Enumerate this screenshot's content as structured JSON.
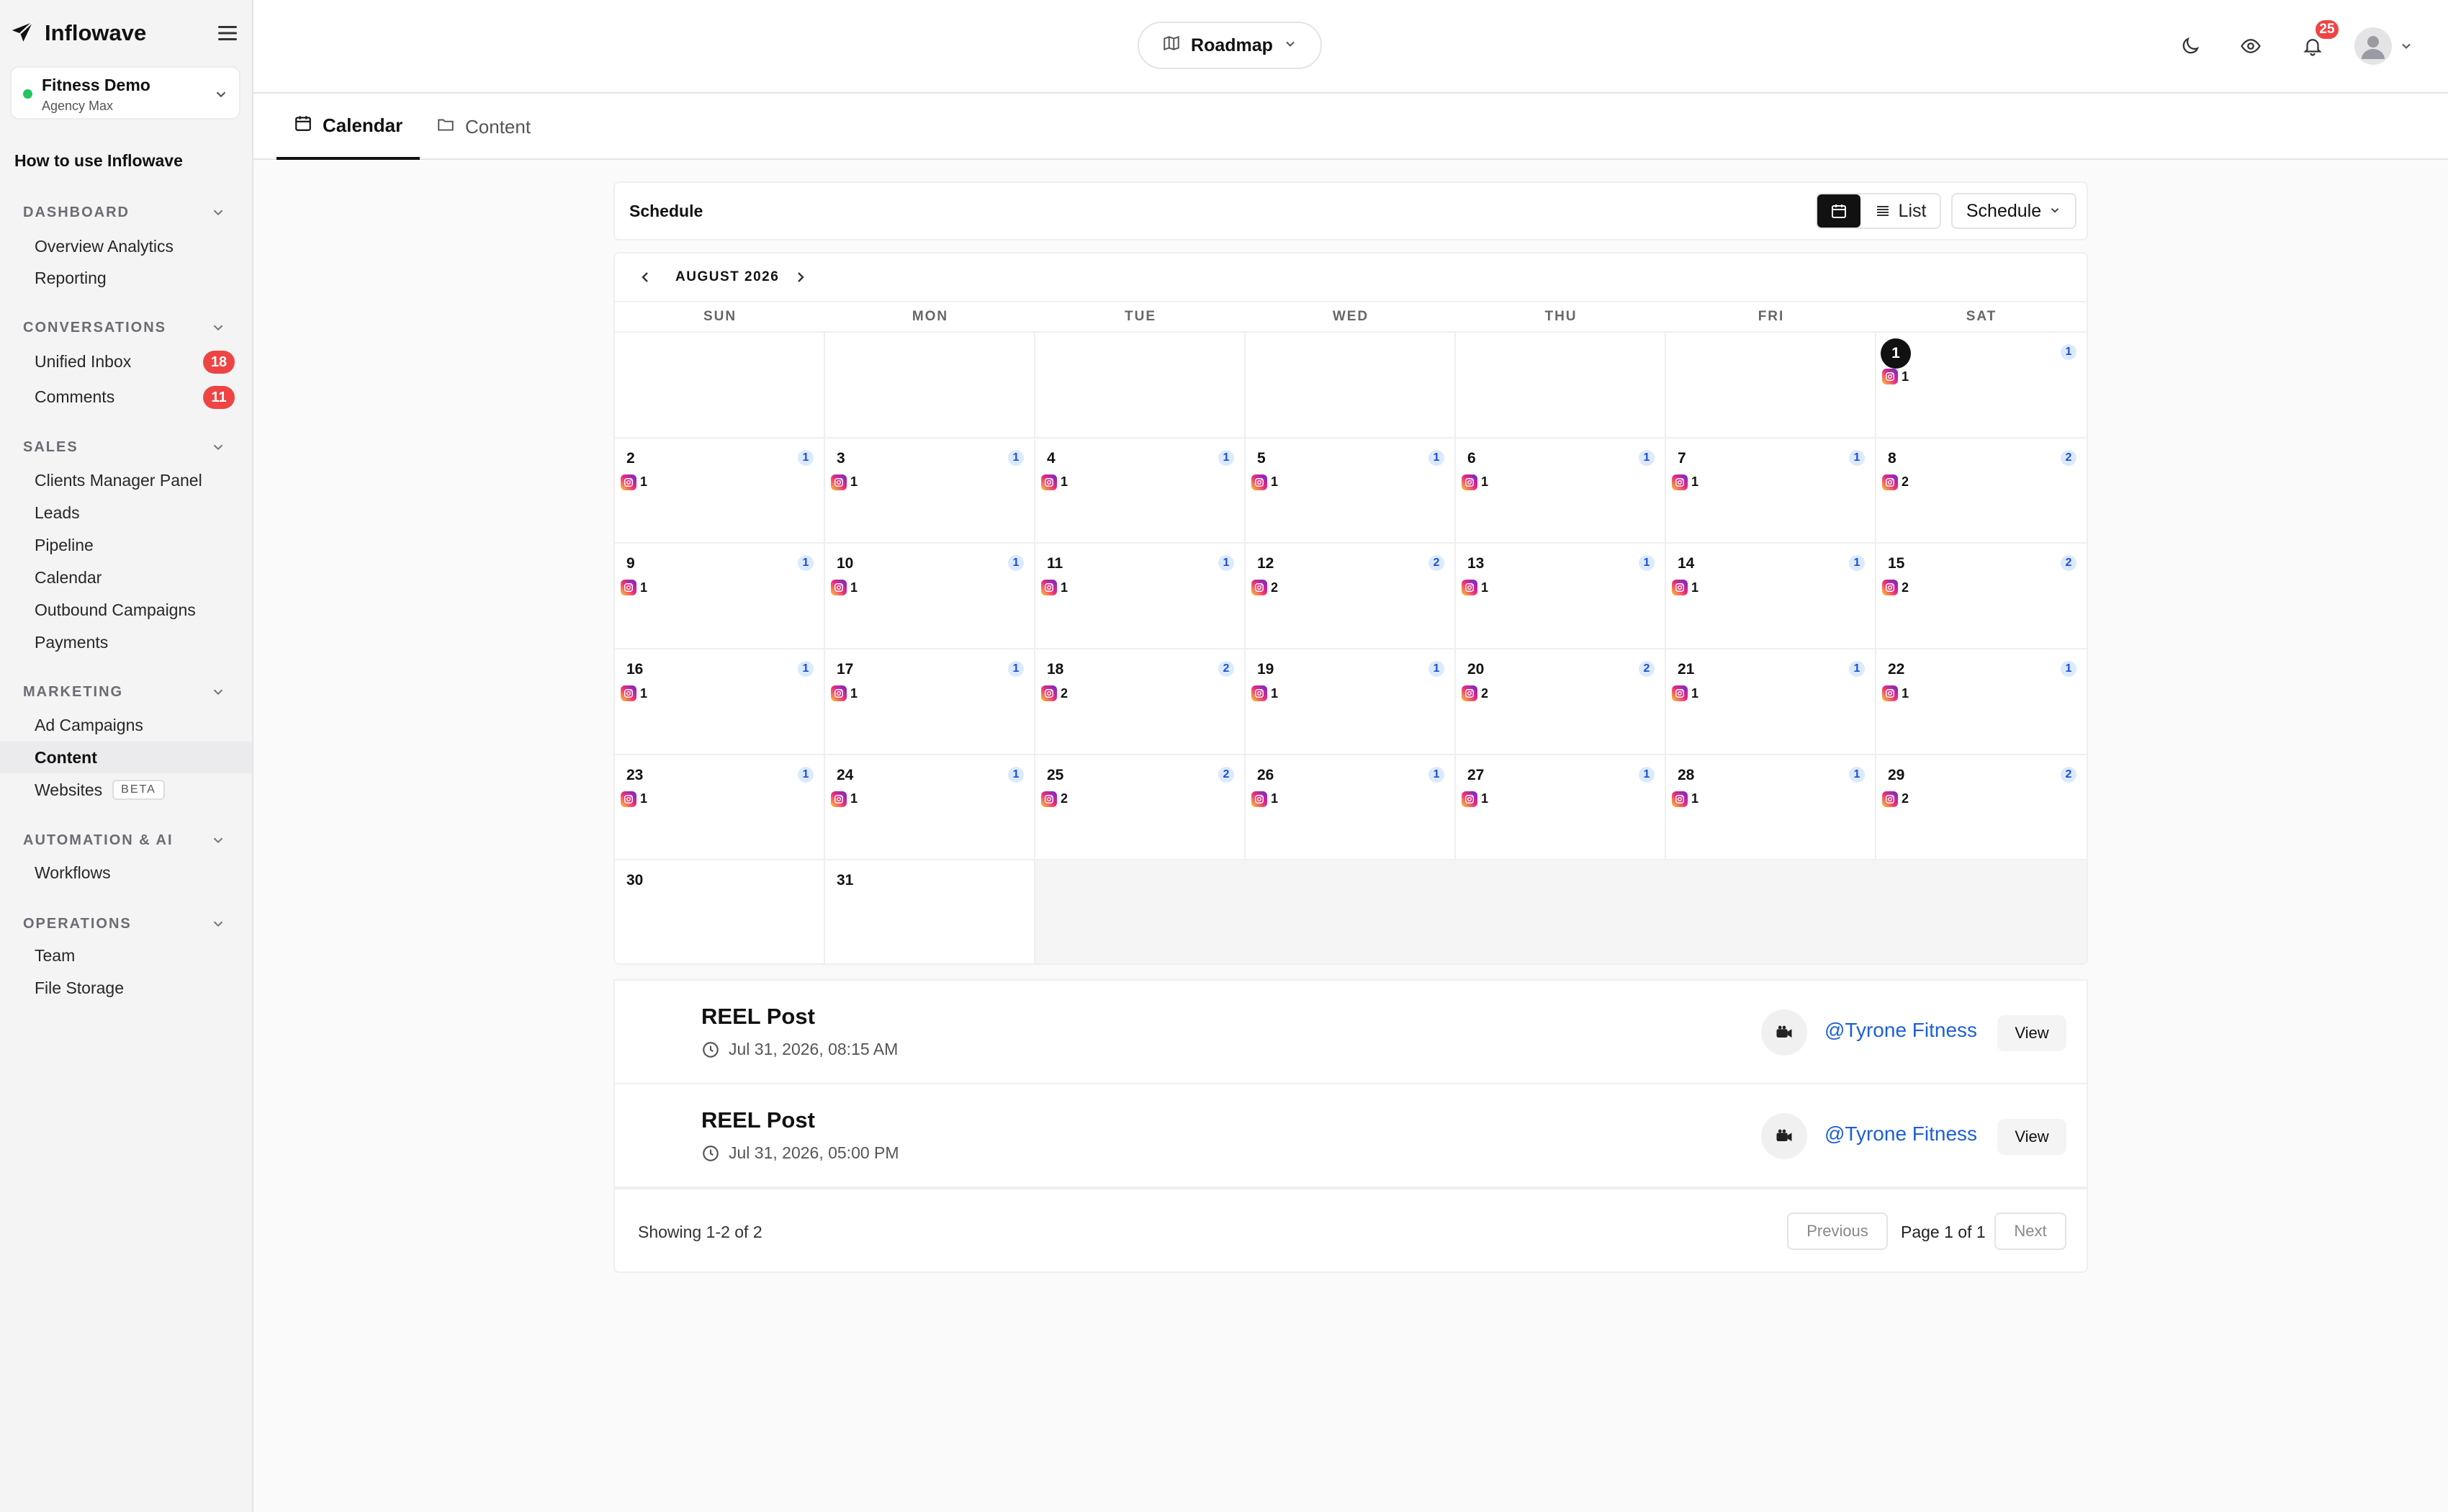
{
  "app": {
    "name": "Inflowave"
  },
  "workspace": {
    "name": "Fitness Demo",
    "subtitle": "Agency Max"
  },
  "help_link": "How to use Inflowave",
  "sidebar": {
    "sections": [
      {
        "title": "DASHBOARD",
        "items": [
          {
            "label": "Overview Analytics"
          },
          {
            "label": "Reporting"
          }
        ]
      },
      {
        "title": "CONVERSATIONS",
        "items": [
          {
            "label": "Unified Inbox",
            "badge": "18"
          },
          {
            "label": "Comments",
            "badge": "11"
          }
        ]
      },
      {
        "title": "SALES",
        "items": [
          {
            "label": "Clients Manager Panel"
          },
          {
            "label": "Leads"
          },
          {
            "label": "Pipeline"
          },
          {
            "label": "Calendar"
          },
          {
            "label": "Outbound Campaigns"
          },
          {
            "label": "Payments"
          }
        ]
      },
      {
        "title": "MARKETING",
        "items": [
          {
            "label": "Ad Campaigns"
          },
          {
            "label": "Content",
            "active": true
          },
          {
            "label": "Websites",
            "tag": "BETA"
          }
        ]
      },
      {
        "title": "AUTOMATION & AI",
        "items": [
          {
            "label": "Workflows"
          }
        ]
      },
      {
        "title": "OPERATIONS",
        "items": [
          {
            "label": "Team"
          },
          {
            "label": "File Storage"
          }
        ]
      }
    ]
  },
  "topbar": {
    "project_selector": "Roadmap",
    "notification_count": "25",
    "icons": [
      "moon-icon",
      "eye-icon",
      "bell-icon",
      "user-avatar-icon"
    ]
  },
  "tabs": [
    {
      "label": "Calendar",
      "active": true
    },
    {
      "label": "Content"
    }
  ],
  "schedule": {
    "title": "Schedule",
    "list_label": "List",
    "dropdown_label": "Schedule"
  },
  "calendar": {
    "month_label": "AUGUST 2026",
    "weekdays": [
      "SUN",
      "MON",
      "TUE",
      "WED",
      "THU",
      "FRI",
      "SAT"
    ],
    "today": 1,
    "days": [
      {
        "day": "",
        "empty": false
      },
      {
        "day": "",
        "empty": false
      },
      {
        "day": "",
        "empty": false
      },
      {
        "day": "",
        "empty": false
      },
      {
        "day": "",
        "empty": false
      },
      {
        "day": "",
        "empty": false
      },
      {
        "day": "1",
        "count": "1",
        "ig": "1",
        "today": true
      },
      {
        "day": "2",
        "count": "1",
        "ig": "1"
      },
      {
        "day": "3",
        "count": "1",
        "ig": "1"
      },
      {
        "day": "4",
        "count": "1",
        "ig": "1"
      },
      {
        "day": "5",
        "count": "1",
        "ig": "1"
      },
      {
        "day": "6",
        "count": "1",
        "ig": "1"
      },
      {
        "day": "7",
        "count": "1",
        "ig": "1"
      },
      {
        "day": "8",
        "count": "2",
        "ig": "2"
      },
      {
        "day": "9",
        "count": "1",
        "ig": "1"
      },
      {
        "day": "10",
        "count": "1",
        "ig": "1"
      },
      {
        "day": "11",
        "count": "1",
        "ig": "1"
      },
      {
        "day": "12",
        "count": "2",
        "ig": "2"
      },
      {
        "day": "13",
        "count": "1",
        "ig": "1"
      },
      {
        "day": "14",
        "count": "1",
        "ig": "1"
      },
      {
        "day": "15",
        "count": "2",
        "ig": "2"
      },
      {
        "day": "16",
        "count": "1",
        "ig": "1"
      },
      {
        "day": "17",
        "count": "1",
        "ig": "1"
      },
      {
        "day": "18",
        "count": "2",
        "ig": "2"
      },
      {
        "day": "19",
        "count": "1",
        "ig": "1"
      },
      {
        "day": "20",
        "count": "2",
        "ig": "2"
      },
      {
        "day": "21",
        "count": "1",
        "ig": "1"
      },
      {
        "day": "22",
        "count": "1",
        "ig": "1"
      },
      {
        "day": "23",
        "count": "1",
        "ig": "1"
      },
      {
        "day": "24",
        "count": "1",
        "ig": "1"
      },
      {
        "day": "25",
        "count": "2",
        "ig": "2"
      },
      {
        "day": "26",
        "count": "1",
        "ig": "1"
      },
      {
        "day": "27",
        "count": "1",
        "ig": "1"
      },
      {
        "day": "28",
        "count": "1",
        "ig": "1"
      },
      {
        "day": "29",
        "count": "2",
        "ig": "2"
      },
      {
        "day": "30"
      },
      {
        "day": "31"
      },
      {
        "day": "",
        "empty": true
      },
      {
        "day": "",
        "empty": true
      },
      {
        "day": "",
        "empty": true
      },
      {
        "day": "",
        "empty": true
      },
      {
        "day": "",
        "empty": true
      }
    ]
  },
  "posts": [
    {
      "title": "REEL Post",
      "time": "Jul 31, 2026, 08:15 AM",
      "handle": "@Tyrone Fitness",
      "action": "View"
    },
    {
      "title": "REEL Post",
      "time": "Jul 31, 2026, 05:00 PM",
      "handle": "@Tyrone Fitness",
      "action": "View"
    }
  ],
  "pagination": {
    "showing": "Showing 1-2 of 2",
    "previous": "Previous",
    "page_label": "Page 1 of 1",
    "next": "Next"
  },
  "colors": {
    "accent": "#111111",
    "badge_red": "#ef4444",
    "count_blue": "#1d4ed8",
    "link_blue": "#1d5fd6",
    "online_green": "#22c55e"
  }
}
